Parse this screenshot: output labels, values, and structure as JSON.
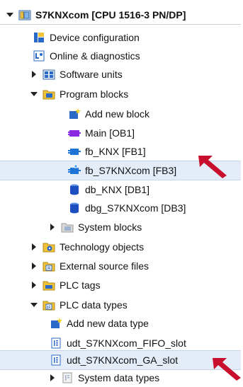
{
  "tree": {
    "root": "S7KNXcom [CPU 1516-3 PN/DP]",
    "device_configuration": "Device configuration",
    "online_diagnostics": "Online & diagnostics",
    "software_units": "Software units",
    "program_blocks": "Program blocks",
    "add_new_block": "Add new block",
    "main_ob1": "Main [OB1]",
    "fb_knx": "fb_KNX [FB1]",
    "fb_s7knxcom": "fb_S7KNXcom [FB3]",
    "db_knx": "db_KNX [DB1]",
    "dbg_s7knxcom": "dbg_S7KNXcom [DB3]",
    "system_blocks": "System blocks",
    "technology_objects": "Technology objects",
    "external_source_files": "External source files",
    "plc_tags": "PLC tags",
    "plc_data_types": "PLC data types",
    "add_new_data_type": "Add new data type",
    "udt_fifo_slot": "udt_S7KNXcom_FIFO_slot",
    "udt_ga_slot": "udt_S7KNXcom_GA_slot",
    "system_data_types": "System data types"
  },
  "colors": {
    "accent_arrow": "#c8102e",
    "selection_bg": "#e4ecf7",
    "folder_yellow": "#f0c23a",
    "block_blue": "#1e74d6",
    "block_purple": "#8a2be2"
  },
  "icons": {
    "expanded": "triangle-down-icon",
    "collapsed": "triangle-right-icon",
    "plc": "plc-cpu-icon",
    "folder": "folder-icon",
    "block": "block-icon",
    "db": "database-cylinder-icon",
    "udt": "data-type-icon",
    "add": "add-new-icon"
  }
}
